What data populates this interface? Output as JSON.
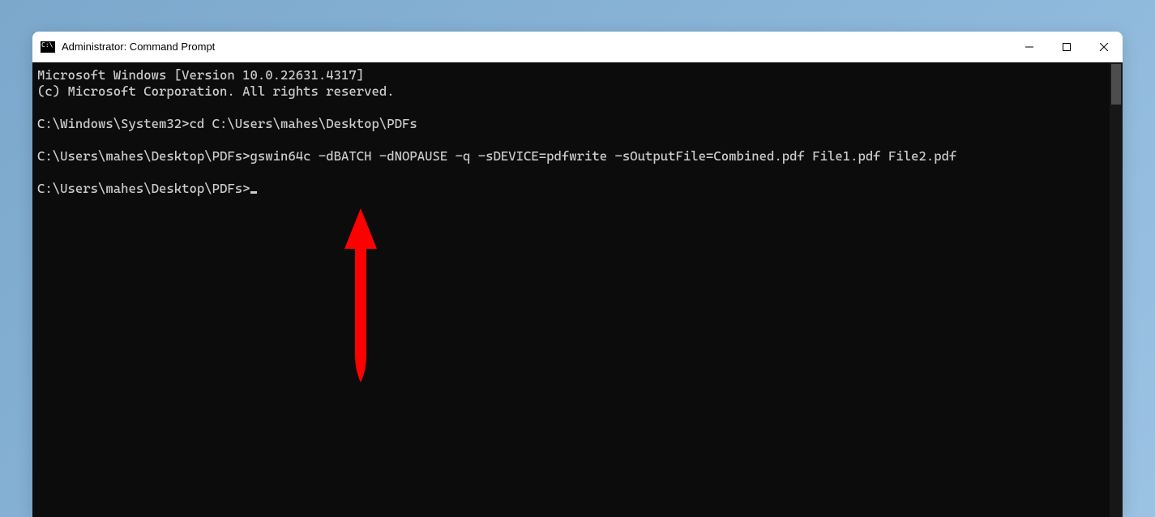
{
  "window": {
    "title": "Administrator: Command Prompt"
  },
  "terminal": {
    "line1": "Microsoft Windows [Version 10.0.22631.4317]",
    "line2": "(c) Microsoft Corporation. All rights reserved.",
    "blank1": "",
    "prompt1": "C:\\Windows\\System32>",
    "command1": "cd C:\\Users\\mahes\\Desktop\\PDFs",
    "blank2": "",
    "prompt2": "C:\\Users\\mahes\\Desktop\\PDFs>",
    "command2": "gswin64c -dBATCH -dNOPAUSE -q -sDEVICE=pdfwrite -sOutputFile=Combined.pdf File1.pdf File2.pdf",
    "blank3": "",
    "prompt3": "C:\\Users\\mahes\\Desktop\\PDFs>"
  },
  "annotation": {
    "color": "#ff0000"
  }
}
